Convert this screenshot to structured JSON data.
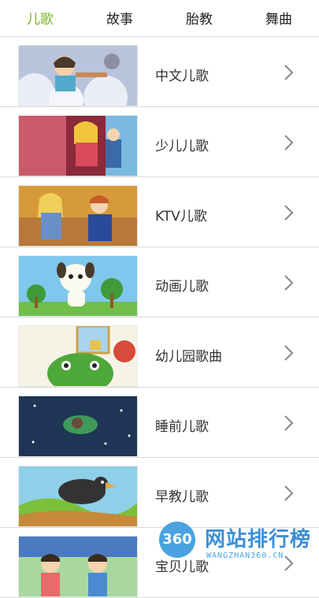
{
  "tabs": [
    {
      "label": "儿歌",
      "active": true
    },
    {
      "label": "故事",
      "active": false
    },
    {
      "label": "胎教",
      "active": false
    },
    {
      "label": "舞曲",
      "active": false
    }
  ],
  "colors": {
    "accent": "#7cb62a",
    "text": "#333333",
    "divider": "#d9d9d9"
  },
  "list": [
    {
      "label": "中文儿歌"
    },
    {
      "label": "少儿儿歌"
    },
    {
      "label": "KTV儿歌"
    },
    {
      "label": "动画儿歌"
    },
    {
      "label": "幼儿园歌曲"
    },
    {
      "label": "睡前儿歌"
    },
    {
      "label": "早教儿歌"
    },
    {
      "label": "宝贝儿歌"
    }
  ],
  "watermark": {
    "logo": "360",
    "title": "网站排行榜",
    "subtitle": "WANGZHAN360.CN"
  }
}
